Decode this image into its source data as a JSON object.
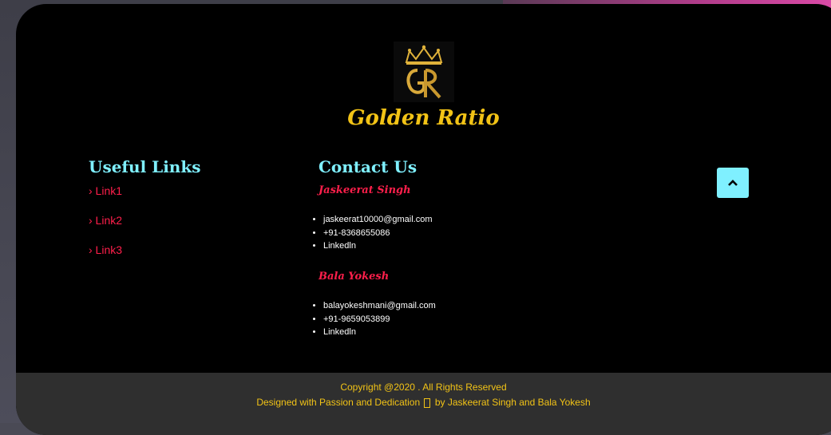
{
  "brand": {
    "name": "Golden Ratio",
    "logo_icon": "golden-ratio-crown-logo"
  },
  "useful_links": {
    "heading": "Useful Links",
    "items": [
      {
        "label": "› Link1"
      },
      {
        "label": "› Link2"
      },
      {
        "label": "› Link3"
      }
    ]
  },
  "contact": {
    "heading": "Contact Us",
    "people": [
      {
        "name": "Jaskeerat Singh",
        "email": "jaskeerat10000@gmail.com",
        "phone": "+91-8368655086",
        "social": "Linkedln"
      },
      {
        "name": "Bala Yokesh",
        "email": "balayokeshmani@gmail.com",
        "phone": "+91-9659053899",
        "social": "Linkedln"
      }
    ]
  },
  "back_to_top": {
    "icon": "chevron-up-icon"
  },
  "footer": {
    "copyright": "Copyright @2020 . All Rights Reserved",
    "designed_prefix": "Designed with Passion and Dedication",
    "designed_suffix": "by Jaskeerat Singh and Bala Yokesh"
  },
  "colors": {
    "gold": "#f2c316",
    "cyan": "#7ff0ff",
    "accent_red": "#ff1f4b",
    "card_bg": "#000000",
    "footer_bg": "#2f2f2f"
  }
}
